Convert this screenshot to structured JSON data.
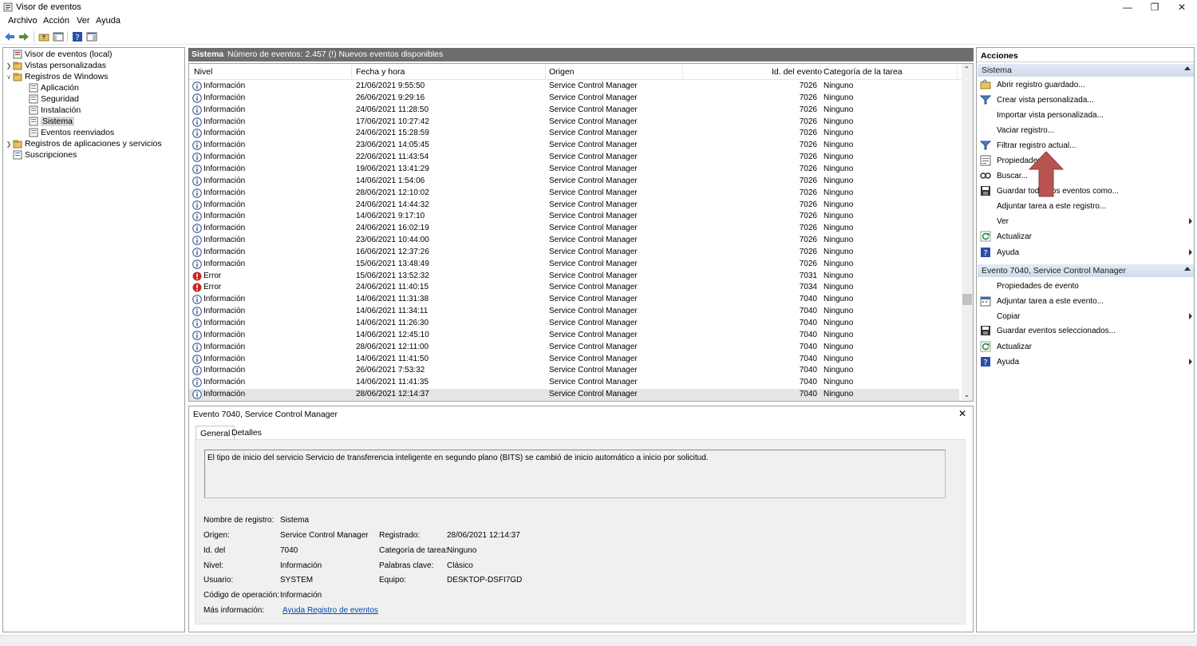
{
  "window": {
    "title": "Visor de eventos"
  },
  "menu": [
    "Archivo",
    "Acción",
    "Ver",
    "Ayuda"
  ],
  "tree": {
    "root": "Visor de eventos (local)",
    "custom_views": "Vistas personalizadas",
    "windows_logs": "Registros de Windows",
    "application": "Aplicación",
    "security": "Seguridad",
    "setup": "Instalación",
    "system": "Sistema",
    "forwarded": "Eventos reenviados",
    "app_services_logs": "Registros de aplicaciones y servicios",
    "subscriptions": "Suscripciones"
  },
  "center": {
    "log_name": "Sistema",
    "summary": "Número de eventos: 2.457 (!) Nuevos eventos disponibles"
  },
  "table": {
    "columns": {
      "level": "Nivel",
      "date": "Fecha y hora",
      "source": "Origen",
      "event_id": "Id. del evento",
      "category": "Categoría de la tarea"
    },
    "rows": [
      {
        "level": "Información",
        "date": "21/06/2021 9:55:50",
        "source": "Service Control Manager",
        "id": "7026",
        "category": "Ninguno"
      },
      {
        "level": "Información",
        "date": "26/06/2021 9:29:16",
        "source": "Service Control Manager",
        "id": "7026",
        "category": "Ninguno"
      },
      {
        "level": "Información",
        "date": "24/06/2021 11:28:50",
        "source": "Service Control Manager",
        "id": "7026",
        "category": "Ninguno"
      },
      {
        "level": "Información",
        "date": "17/06/2021 10:27:42",
        "source": "Service Control Manager",
        "id": "7026",
        "category": "Ninguno"
      },
      {
        "level": "Información",
        "date": "24/06/2021 15:28:59",
        "source": "Service Control Manager",
        "id": "7026",
        "category": "Ninguno"
      },
      {
        "level": "Información",
        "date": "23/06/2021 14:05:45",
        "source": "Service Control Manager",
        "id": "7026",
        "category": "Ninguno"
      },
      {
        "level": "Información",
        "date": "22/06/2021 11:43:54",
        "source": "Service Control Manager",
        "id": "7026",
        "category": "Ninguno"
      },
      {
        "level": "Información",
        "date": "19/06/2021 13:41:29",
        "source": "Service Control Manager",
        "id": "7026",
        "category": "Ninguno"
      },
      {
        "level": "Información",
        "date": "14/06/2021 1:54:06",
        "source": "Service Control Manager",
        "id": "7026",
        "category": "Ninguno"
      },
      {
        "level": "Información",
        "date": "28/06/2021 12:10:02",
        "source": "Service Control Manager",
        "id": "7026",
        "category": "Ninguno"
      },
      {
        "level": "Información",
        "date": "24/06/2021 14:44:32",
        "source": "Service Control Manager",
        "id": "7026",
        "category": "Ninguno"
      },
      {
        "level": "Información",
        "date": "14/06/2021 9:17:10",
        "source": "Service Control Manager",
        "id": "7026",
        "category": "Ninguno"
      },
      {
        "level": "Información",
        "date": "24/06/2021 16:02:19",
        "source": "Service Control Manager",
        "id": "7026",
        "category": "Ninguno"
      },
      {
        "level": "Información",
        "date": "23/06/2021 10:44:00",
        "source": "Service Control Manager",
        "id": "7026",
        "category": "Ninguno"
      },
      {
        "level": "Información",
        "date": "16/06/2021 12:37:26",
        "source": "Service Control Manager",
        "id": "7026",
        "category": "Ninguno"
      },
      {
        "level": "Información",
        "date": "15/06/2021 13:48:49",
        "source": "Service Control Manager",
        "id": "7026",
        "category": "Ninguno"
      },
      {
        "level": "Error",
        "date": "15/06/2021 13:52:32",
        "source": "Service Control Manager",
        "id": "7031",
        "category": "Ninguno"
      },
      {
        "level": "Error",
        "date": "24/06/2021 11:40:15",
        "source": "Service Control Manager",
        "id": "7034",
        "category": "Ninguno"
      },
      {
        "level": "Información",
        "date": "14/06/2021 11:31:38",
        "source": "Service Control Manager",
        "id": "7040",
        "category": "Ninguno"
      },
      {
        "level": "Información",
        "date": "14/06/2021 11:34:11",
        "source": "Service Control Manager",
        "id": "7040",
        "category": "Ninguno"
      },
      {
        "level": "Información",
        "date": "14/06/2021 11:26:30",
        "source": "Service Control Manager",
        "id": "7040",
        "category": "Ninguno"
      },
      {
        "level": "Información",
        "date": "14/06/2021 12:45:10",
        "source": "Service Control Manager",
        "id": "7040",
        "category": "Ninguno"
      },
      {
        "level": "Información",
        "date": "28/06/2021 12:11:00",
        "source": "Service Control Manager",
        "id": "7040",
        "category": "Ninguno"
      },
      {
        "level": "Información",
        "date": "14/06/2021 11:41:50",
        "source": "Service Control Manager",
        "id": "7040",
        "category": "Ninguno"
      },
      {
        "level": "Información",
        "date": "26/06/2021 7:53:32",
        "source": "Service Control Manager",
        "id": "7040",
        "category": "Ninguno"
      },
      {
        "level": "Información",
        "date": "14/06/2021 11:41:35",
        "source": "Service Control Manager",
        "id": "7040",
        "category": "Ninguno"
      },
      {
        "level": "Información",
        "date": "28/06/2021 12:14:37",
        "source": "Service Control Manager",
        "id": "7040",
        "category": "Ninguno"
      }
    ]
  },
  "detail": {
    "title": "Evento 7040, Service Control Manager",
    "tabs": [
      "General",
      "Detalles"
    ],
    "description": "El tipo de inicio del servicio Servicio de transferencia inteligente en segundo plano (BITS) se cambió de inicio automático a inicio por solicitud.",
    "labels": {
      "log_name": "Nombre de registro:",
      "source": "Origen:",
      "event_id": "Id. del",
      "level": "Nivel:",
      "user": "Usuario:",
      "opcode": "Código de operación:",
      "more_info": "Más información:",
      "logged": "Registrado:",
      "task_category": "Categoría de tarea:",
      "keywords": "Palabras clave:",
      "computer": "Equipo:"
    },
    "values": {
      "log_name": "Sistema",
      "source": "Service Control Manager",
      "event_id": "7040",
      "level": "Información",
      "user": "SYSTEM",
      "opcode": "Información",
      "more_info_link": "Ayuda Registro de eventos",
      "logged": "28/06/2021 12:14:37",
      "task_category": "Ninguno",
      "keywords": "Clásico",
      "computer": "DESKTOP-DSFI7GD"
    }
  },
  "actions": {
    "header": "Acciones",
    "section1": "Sistema",
    "items1": [
      "Abrir registro guardado...",
      "Crear vista personalizada...",
      "Importar vista personalizada...",
      "Vaciar registro...",
      "Filtrar registro actual...",
      "Propiedades",
      "Buscar...",
      "Guardar todos los eventos como...",
      "Adjuntar tarea a este registro...",
      "Ver",
      "Actualizar",
      "Ayuda"
    ],
    "section2": "Evento 7040, Service Control Manager",
    "items2": [
      "Propiedades de evento",
      "Adjuntar tarea a este evento...",
      "Copiar",
      "Guardar eventos seleccionados...",
      "Actualizar",
      "Ayuda"
    ]
  },
  "colors": {
    "arrow": "#b85450",
    "section_header": "#dbe5f1",
    "selected_row": "#e5e5e5"
  }
}
